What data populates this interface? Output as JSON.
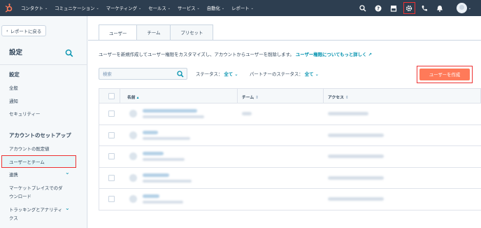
{
  "nav": {
    "items": [
      "コンタクト",
      "コミュニケーション",
      "マーケティング",
      "セールス",
      "サービス",
      "自動化",
      "レポート"
    ]
  },
  "sidebar": {
    "back_label": "レポートに戻る",
    "title": "設定",
    "section1": "設定",
    "items1": [
      "全般",
      "通知",
      "セキュリティー"
    ],
    "section2": "アカウントのセットアップ",
    "items2": [
      "アカウントの既定値",
      "ユーザーとチーム",
      "連携",
      "マーケットプレイスでのダ",
      "ウンロード",
      "トラッキングとアナリティ",
      "クス"
    ]
  },
  "main": {
    "tabs": [
      "ユーザー",
      "チーム",
      "プリセット"
    ],
    "description": "ユーザーを新規作成してユーザー権限をカスタマイズし、アカウントからユーザーを削除します。",
    "description_link": "ユーザー権限についてもっと詳しく",
    "search_placeholder": "検索",
    "status_label": "ステータス：",
    "status_value": "全て",
    "partner_label": "パートナーのステータス：",
    "partner_value": "全て",
    "create_button": "ユーザーを作成",
    "columns": [
      "名前",
      "チーム",
      "アクセス"
    ]
  },
  "colors": {
    "accent": "#0091ae",
    "cta": "#ff7a59",
    "nav_bg": "#2d3e50",
    "highlight": "#ee3333"
  }
}
